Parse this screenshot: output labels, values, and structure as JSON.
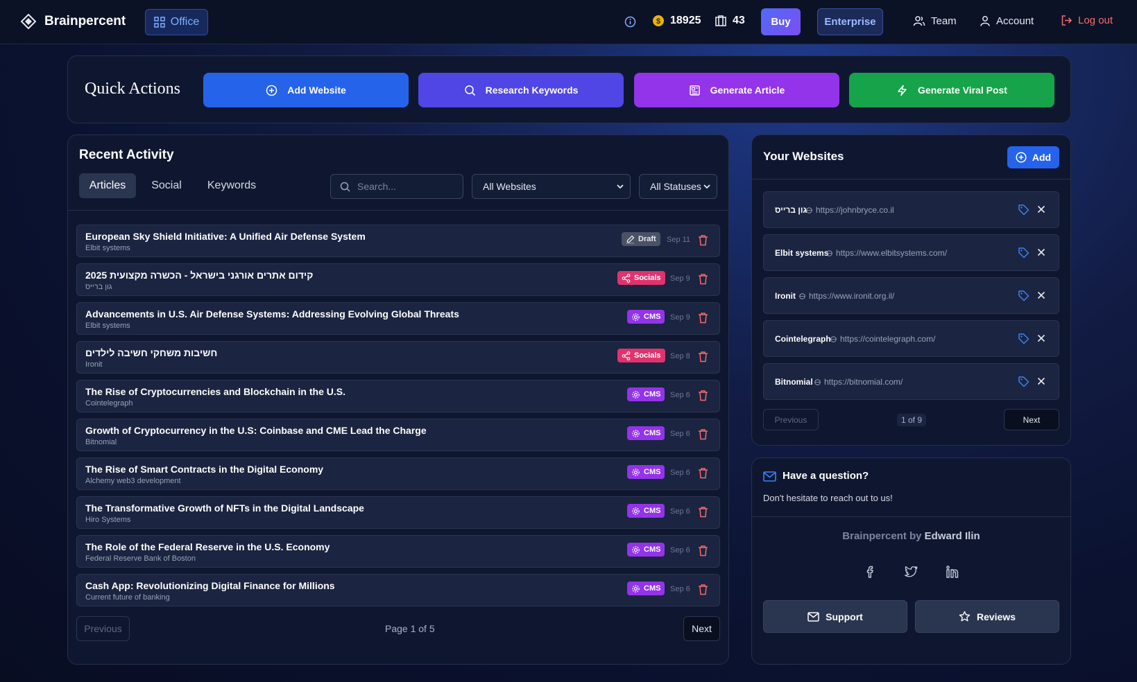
{
  "header": {
    "brand": "Brainpercent",
    "office_label": "Office",
    "coins": "18925",
    "credits": "43",
    "buy_label": "Buy",
    "enterprise_label": "Enterprise",
    "team_label": "Team",
    "account_label": "Account",
    "logout_label": "Log out"
  },
  "quick_actions": {
    "title": "Quick Actions",
    "buttons": [
      {
        "label": "Add Website",
        "icon": "plus-circle-icon",
        "color": "#2563eb"
      },
      {
        "label": "Research Keywords",
        "icon": "search-icon",
        "color": "#4f46e5"
      },
      {
        "label": "Generate Article",
        "icon": "newspaper-icon",
        "color": "#9333ea"
      },
      {
        "label": "Generate Viral Post",
        "icon": "lightning-icon",
        "color": "#16a34a"
      }
    ]
  },
  "recent_activity": {
    "title": "Recent Activity",
    "tabs": [
      "Articles",
      "Social",
      "Keywords"
    ],
    "active_tab": "Articles",
    "search_placeholder": "Search...",
    "website_filter": "All Websites",
    "status_filter": "All Statuses",
    "items": [
      {
        "title": "European Sky Shield Initiative: A Unified Air Defense System",
        "site": "Elbit systems",
        "status": "Draft",
        "date": "Sep 11"
      },
      {
        "title": "קידום אתרים אורגני בישראל - הכשרה מקצועית 2025",
        "site": "גון ברייס",
        "status": "Socials",
        "date": "Sep 9"
      },
      {
        "title": "Advancements in U.S. Air Defense Systems: Addressing Evolving Global Threats",
        "site": "Elbit systems",
        "status": "CMS",
        "date": "Sep 9"
      },
      {
        "title": "חשיבות משחקי חשיבה לילדים",
        "site": "Ironit",
        "status": "Socials",
        "date": "Sep 8"
      },
      {
        "title": "The Rise of Cryptocurrencies and Blockchain in the U.S.",
        "site": "Cointelegraph",
        "status": "CMS",
        "date": "Sep 6"
      },
      {
        "title": "Growth of Cryptocurrency in the U.S: Coinbase and CME Lead the Charge",
        "site": "Bitnomial",
        "status": "CMS",
        "date": "Sep 6"
      },
      {
        "title": "The Rise of Smart Contracts in the Digital Economy",
        "site": "Alchemy web3 development",
        "status": "CMS",
        "date": "Sep 6"
      },
      {
        "title": "The Transformative Growth of NFTs in the Digital Landscape",
        "site": "Hiro Systems",
        "status": "CMS",
        "date": "Sep 6"
      },
      {
        "title": "The Role of the Federal Reserve in the U.S. Economy",
        "site": "Federal Reserve Bank of Boston",
        "status": "CMS",
        "date": "Sep 6"
      },
      {
        "title": "Cash App: Revolutionizing Digital Finance for Millions",
        "site": "Current future of banking",
        "status": "CMS",
        "date": "Sep 6"
      }
    ],
    "pager": {
      "prev": "Previous",
      "page_text": "Page 1 of 5",
      "next": "Next"
    }
  },
  "websites": {
    "title": "Your Websites",
    "add_label": "Add",
    "items": [
      {
        "name": "גון ברייס",
        "url": "https://johnbryce.co.il"
      },
      {
        "name": "Elbit systems",
        "url": "https://www.elbitsystems.com/"
      },
      {
        "name": "Ironit",
        "url": "https://www.ironit.org.il/"
      },
      {
        "name": "Cointelegraph",
        "url": "https://cointelegraph.com/"
      },
      {
        "name": "Bitnomial",
        "url": "https://bitnomial.com/"
      }
    ],
    "pager": {
      "prev": "Previous",
      "page_text": "1 of 9",
      "next": "Next"
    }
  },
  "question": {
    "title": "Have a question?",
    "subtitle": "Don't hesitate to reach out to us!",
    "credit_prefix": "Brainpercent by ",
    "credit_author": "Edward Ilin",
    "support_label": "Support",
    "reviews_label": "Reviews"
  }
}
